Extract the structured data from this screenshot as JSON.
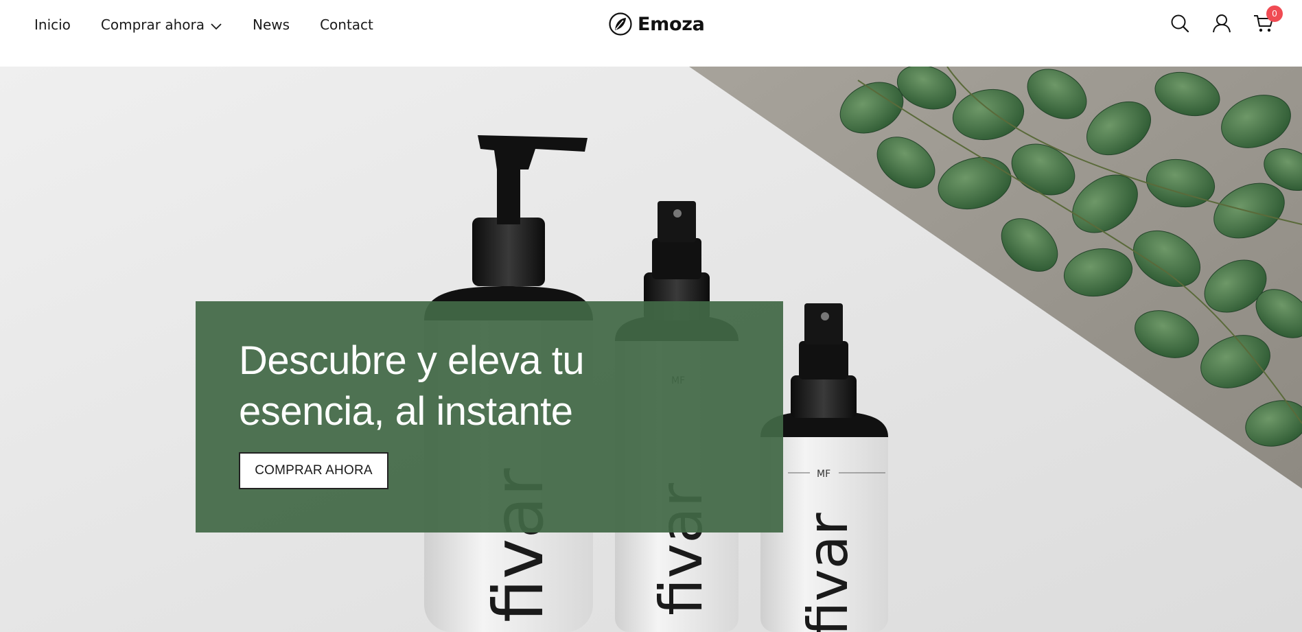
{
  "nav": {
    "items": [
      {
        "label": "Inicio"
      },
      {
        "label": "Comprar ahora",
        "has_dropdown": true
      },
      {
        "label": "News"
      },
      {
        "label": "Contact"
      }
    ]
  },
  "brand": {
    "name": "Emoza",
    "icon": "leaf-circle-icon"
  },
  "header_icons": [
    "search-icon",
    "user-icon",
    "cart-icon"
  ],
  "cart": {
    "count": "0",
    "badge_color": "#f04b53"
  },
  "hero": {
    "title": "Descubre y eleva tu esencia, al instante",
    "button_label": "COMPRAR AHORA",
    "overlay_color": "#426846",
    "image": {
      "bottle_brand": "fivar",
      "bottle_monogram": "MF"
    }
  }
}
